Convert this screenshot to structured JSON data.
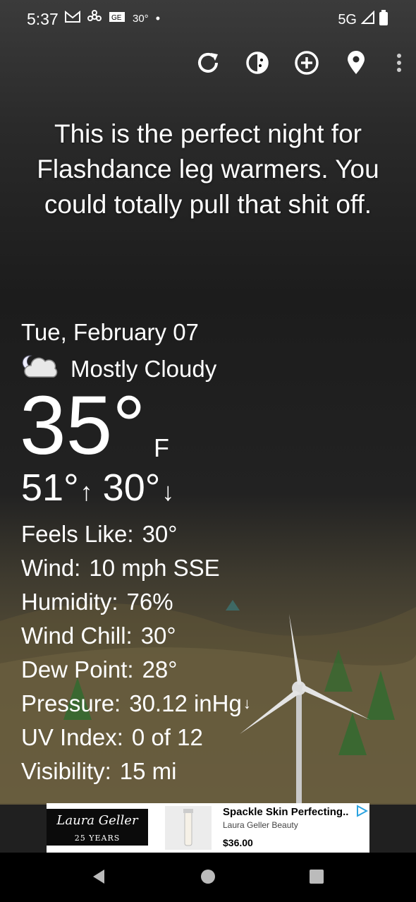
{
  "status": {
    "time": "5:37",
    "temp": "30°",
    "network": "5G"
  },
  "toolbar": {
    "icons": [
      "refresh-icon",
      "theme-icon",
      "add-location-icon",
      "location-pin-icon",
      "more-vert-icon"
    ]
  },
  "quote": "This is the perfect night for Flashdance leg warmers. You could totally pull that shit off.",
  "weather": {
    "date": "Tue, February 07",
    "condition": "Mostly Cloudy",
    "temperature": "35°",
    "unit": "F",
    "high": "51°",
    "low": "30°"
  },
  "details": [
    {
      "label": "Feels Like:",
      "value": "30°"
    },
    {
      "label": "Wind:",
      "value": "10 mph SSE"
    },
    {
      "label": "Humidity:",
      "value": "76%"
    },
    {
      "label": "Wind Chill:",
      "value": "30°"
    },
    {
      "label": "Dew Point:",
      "value": "28°"
    },
    {
      "label": "Pressure:",
      "value": "30.12 inHg"
    },
    {
      "label": "UV Index:",
      "value": "0 of 12"
    },
    {
      "label": "Visibility:",
      "value": "15 mi"
    }
  ],
  "ad": {
    "logo_text": "Laura Geller",
    "logo_years": "25 YEARS",
    "title": "Spackle Skin Perfecting..",
    "brand": "Laura Geller Beauty",
    "price": "$36.00"
  }
}
